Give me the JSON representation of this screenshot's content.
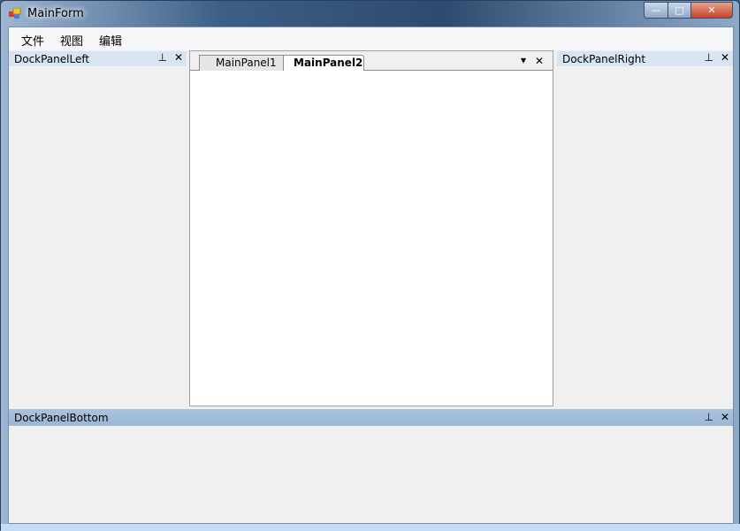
{
  "window": {
    "title": "MainForm",
    "minimize": "—",
    "maximize": "□",
    "close": "✕"
  },
  "menu": [
    {
      "label": "文件"
    },
    {
      "label": "视图"
    },
    {
      "label": "编辑"
    }
  ],
  "left_panel": {
    "title": "DockPanelLeft",
    "pin": "⊥",
    "close": "✕"
  },
  "right_panel": {
    "title": "DockPanelRight",
    "pin": "⊥",
    "close": "✕"
  },
  "bottom_panel": {
    "title": "DockPanelBottom",
    "pin": "⊥",
    "close": "✕"
  },
  "document": {
    "tabs": [
      {
        "label": "MainPanel1",
        "active": false
      },
      {
        "label": "MainPanel2",
        "active": true
      }
    ],
    "dropdown": "▾",
    "close": "✕"
  }
}
